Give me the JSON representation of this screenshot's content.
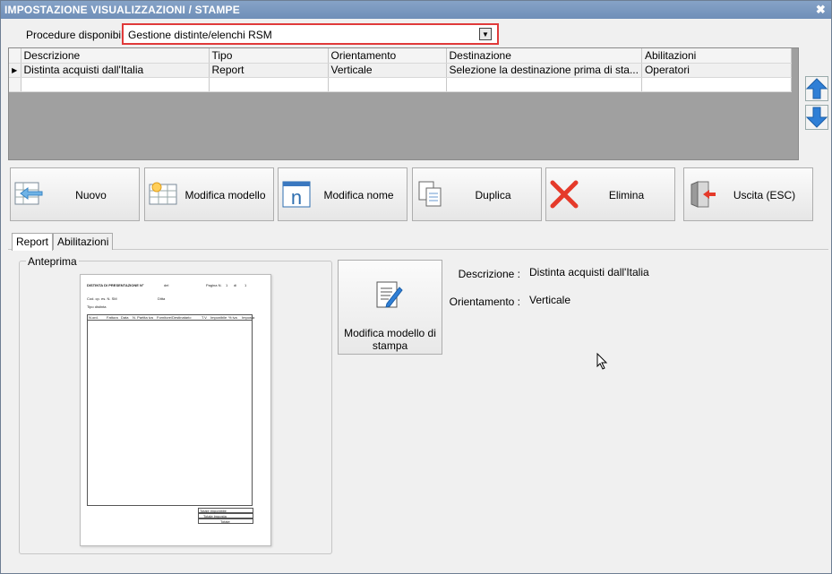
{
  "window": {
    "title": "IMPOSTAZIONE VISUALIZZAZIONI / STAMPE",
    "close_label": "✖"
  },
  "procedure": {
    "label": "Procedure disponibili :",
    "value": "Gestione distinte/elenchi RSM"
  },
  "grid": {
    "columns": [
      "Descrizione",
      "Tipo",
      "Orientamento",
      "Destinazione",
      "Abilitazioni"
    ],
    "rows": [
      [
        "Distinta acquisti dall'Italia",
        "Report",
        "Verticale",
        "Selezione la destinazione prima di sta...",
        "Operatori"
      ]
    ]
  },
  "toolbar": {
    "nuovo": "Nuovo",
    "modifica_modello": "Modifica modello",
    "modifica_nome": "Modifica nome",
    "duplica": "Duplica",
    "elimina": "Elimina",
    "uscita": "Uscita (ESC)"
  },
  "tabs": {
    "report": "Report",
    "abilitazioni": "Abilitazioni"
  },
  "preview": {
    "legend": "Anteprima",
    "paper": {
      "title": "DISTINTA DI PRESENTAZIONE N°",
      "del": "del",
      "pagina": "Pagina N.",
      "page_num": "1",
      "di": "di",
      "page_total": "1",
      "cod": "Cod. cp. es. N. SM",
      "ditta": "Ditta",
      "tipo": "Tipo distinta",
      "cols": [
        "N.ord.",
        "Fattura",
        "Data",
        "N. Partita iva",
        "Fornitore/Destinatario",
        "T.V.",
        "Imponibile",
        "% iva",
        "Imposta"
      ],
      "totals": [
        "Totale imponibile",
        "Totale imposta",
        "Totale"
      ]
    }
  },
  "big_button": {
    "label": "Modifica modello di stampa"
  },
  "info": {
    "descrizione_label": "Descrizione :",
    "descrizione_value": "Distinta acquisti dall'Italia",
    "orientamento_label": "Orientamento :",
    "orientamento_value": "Verticale"
  },
  "colors": {
    "title_bar": "#7593bd",
    "highlight_border": "#e03a3a",
    "arrow_blue": "#2f7fd6",
    "delete_red": "#e53a2a"
  }
}
